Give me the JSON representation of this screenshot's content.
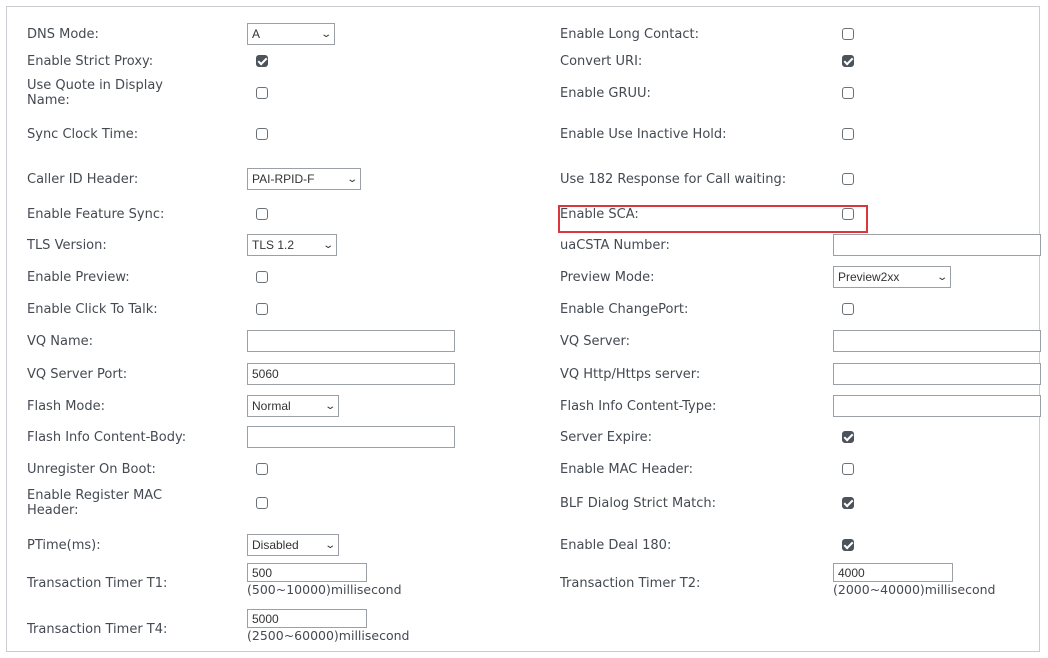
{
  "settings": {
    "dns_mode": {
      "label": "DNS Mode:",
      "value": "A"
    },
    "enable_strict_proxy": {
      "label": "Enable Strict Proxy:",
      "checked": true
    },
    "use_quote_display_name": {
      "label": "Use Quote in Display Name:",
      "checked": false
    },
    "sync_clock_time": {
      "label": "Sync Clock Time:",
      "checked": false
    },
    "caller_id_header": {
      "label": "Caller ID Header:",
      "value": "PAI-RPID-F"
    },
    "enable_feature_sync": {
      "label": "Enable Feature Sync:",
      "checked": false
    },
    "tls_version": {
      "label": "TLS Version:",
      "value": "TLS 1.2"
    },
    "enable_preview": {
      "label": "Enable Preview:",
      "checked": false
    },
    "enable_click_to_talk": {
      "label": "Enable Click To Talk:",
      "checked": false
    },
    "vq_name": {
      "label": "VQ Name:",
      "value": ""
    },
    "vq_server_port": {
      "label": "VQ Server Port:",
      "value": "5060"
    },
    "flash_mode": {
      "label": "Flash Mode:",
      "value": "Normal"
    },
    "flash_info_content_body": {
      "label": "Flash Info Content-Body:",
      "value": ""
    },
    "unregister_on_boot": {
      "label": "Unregister On Boot:",
      "checked": false
    },
    "enable_register_mac_header": {
      "label": "Enable Register MAC Header:",
      "checked": false
    },
    "ptime": {
      "label": "PTime(ms):",
      "value": "Disabled"
    },
    "transaction_timer_t1": {
      "label": "Transaction Timer T1:",
      "value": "500",
      "hint": "(500~10000)millisecond"
    },
    "transaction_timer_t4": {
      "label": "Transaction Timer T4:",
      "value": "5000",
      "hint": "(2500~60000)millisecond"
    },
    "enable_long_contact": {
      "label": "Enable Long Contact:",
      "checked": false
    },
    "convert_uri": {
      "label": "Convert URI:",
      "checked": true
    },
    "enable_gruu": {
      "label": "Enable GRUU:",
      "checked": false
    },
    "enable_use_inactive_hold": {
      "label": "Enable Use Inactive Hold:",
      "checked": false
    },
    "use_182_response": {
      "label": "Use 182 Response for Call waiting:",
      "checked": false
    },
    "enable_sca": {
      "label": "Enable SCA:",
      "checked": false
    },
    "uacsta_number": {
      "label": "uaCSTA Number:",
      "value": ""
    },
    "preview_mode": {
      "label": "Preview Mode:",
      "value": "Preview2xx"
    },
    "enable_changeport": {
      "label": "Enable ChangePort:",
      "checked": false
    },
    "vq_server": {
      "label": "VQ Server:",
      "value": ""
    },
    "vq_http_server": {
      "label": "VQ Http/Https server:",
      "value": ""
    },
    "flash_info_content_type": {
      "label": "Flash Info Content-Type:",
      "value": ""
    },
    "server_expire": {
      "label": "Server Expire:",
      "checked": true
    },
    "enable_mac_header": {
      "label": "Enable MAC Header:",
      "checked": false
    },
    "blf_dialog_strict_match": {
      "label": "BLF Dialog Strict Match:",
      "checked": true
    },
    "enable_deal_180": {
      "label": "Enable Deal 180:",
      "checked": true
    },
    "transaction_timer_t2": {
      "label": "Transaction Timer T2:",
      "value": "4000",
      "hint": "(2000~40000)millisecond"
    }
  },
  "icons": {
    "dropdown": "chevron-down-icon",
    "checked": "checkmark-icon"
  },
  "colors": {
    "highlight": "#d9363e",
    "checkbox_on": "#4c535b",
    "border": "#c9cdd2"
  }
}
